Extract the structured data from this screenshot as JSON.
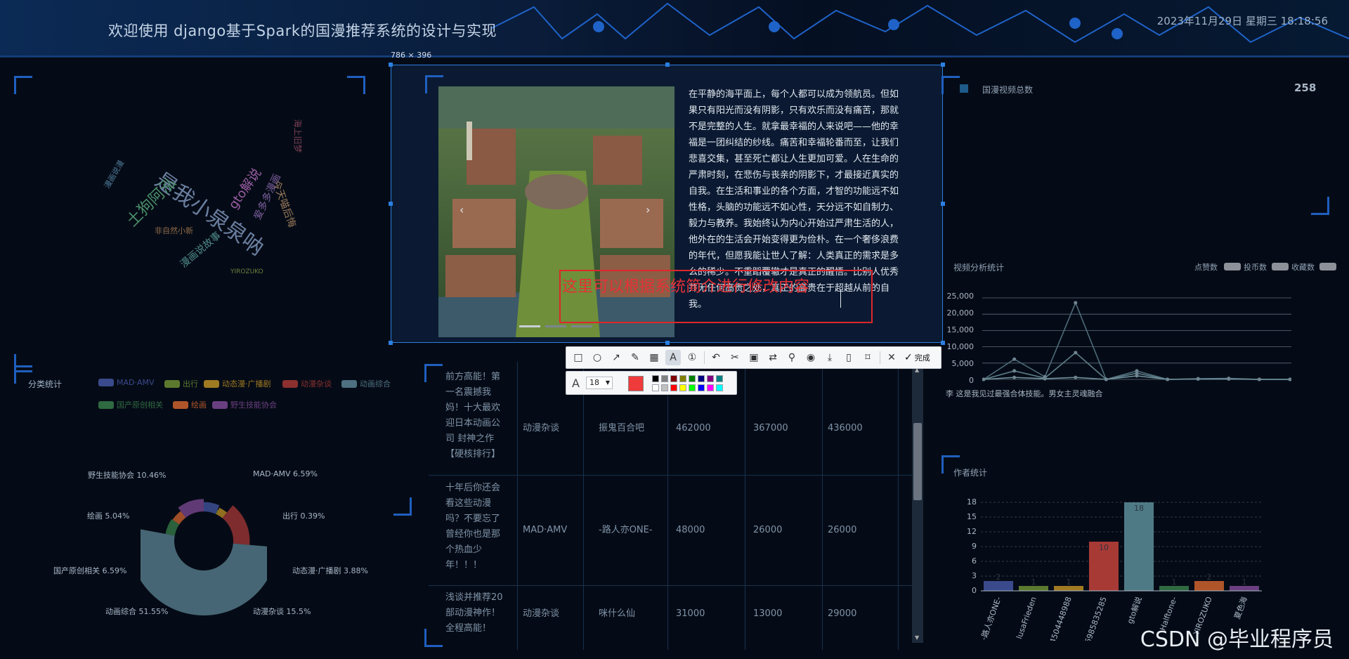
{
  "header": {
    "title": "欢迎使用 django基于Spark的国漫推荐系统的设计与实现",
    "datetime": "2023年11月29日 星期三 18:18:56"
  },
  "wordcloud": {
    "words": [
      {
        "text": "是我小泉泉呐",
        "color": "#6b7fa0"
      },
      {
        "text": "土狗阿泓",
        "color": "#4b8f6a"
      },
      {
        "text": "gto解说",
        "color": "#9a5ea3"
      },
      {
        "text": "爱多多漫画",
        "color": "#7c5f9e"
      },
      {
        "text": "今天喵后悔",
        "color": "#9a7a5a"
      },
      {
        "text": "漫画说故事",
        "color": "#4e8a8a"
      },
      {
        "text": "非自然小新",
        "color": "#8f6a4a"
      },
      {
        "text": "海上旧梦",
        "color": "#7a3f55"
      },
      {
        "text": "YIROZUKO",
        "color": "#6d7f3f"
      },
      {
        "text": "漫画说漫",
        "color": "#4f7b9a"
      }
    ]
  },
  "category": {
    "title": "分类统计",
    "legend": [
      {
        "label": "MAD·AMV",
        "color": "#3a4a8c"
      },
      {
        "label": "出行",
        "color": "#5c7a2e"
      },
      {
        "label": "动态漫·广播剧",
        "color": "#a07a22"
      },
      {
        "label": "动漫杂谈",
        "color": "#8c3030"
      },
      {
        "label": "动画综合",
        "color": "#4e7080"
      },
      {
        "label": "国产原创相关",
        "color": "#2f6a40"
      },
      {
        "label": "绘画",
        "color": "#b0552a"
      },
      {
        "label": "野生技能协会",
        "color": "#6a3f80"
      }
    ],
    "pie_labels": [
      "野生技能协会 10.46%",
      "MAD·AMV 6.59%",
      "绘画 5.04%",
      "出行 0.39%",
      "国产原创相关 6.59%",
      "动态漫·广播剧 3.88%",
      "动画综合 51.55%",
      "动漫杂谈 15.5%"
    ]
  },
  "table": {
    "rows": [
      {
        "title": "前方高能！第一名震撼我妈！十大最欢迎日本动画公司 封神之作【硬核排行】",
        "category": "动漫杂谈",
        "author": "振鬼百合吧",
        "c1": "462000",
        "c2": "367000",
        "c3": "436000"
      },
      {
        "title": "十年后你还会看这些动漫吗？不要忘了曾经你也是那个热血少年！！！",
        "category": "MAD·AMV",
        "author": "-路人亦ONE-",
        "c1": "48000",
        "c2": "26000",
        "c3": "26000"
      },
      {
        "title": "浅谈并推荐20部动漫神作！全程高能！",
        "category": "动漫杂谈",
        "author": "咪什么仙",
        "c1": "31000",
        "c2": "13000",
        "c3": "29000"
      }
    ]
  },
  "selection": {
    "size_label": "786 × 396",
    "slide_text": "在平静的海平面上，每个人都可以成为领航员。但如果只有阳光而没有阴影，只有欢乐而没有痛苦，那就不是完整的人生。就拿最幸福的人来说吧——他的幸福是一团纠结的纱线。痛苦和幸福轮番而至，让我们悲喜交集，甚至死亡都让人生更加可爱。人在生命的严肃时刻，在悲伤与丧亲的阴影下，才最接近真实的自我。在生活和事业的各个方面，才智的功能远不如性格，头脑的功能远不如心性，天分远不如自制力、毅力与教养。我始终认为内心开始过严肃生活的人，他外在的生活会开始变得更为俭朴。在一个奢侈浪费的年代，但愿我能让世人了解：人类真正的需求是多么的稀少。不重蹈覆辙才是真正的醒悟。比别人优秀并无任何高贵之处，真正的高贵在于超越从前的自我。",
    "annotation": "这里可以根据系统简介进行修改内容",
    "arrow_prev": "‹",
    "arrow_next": "›"
  },
  "toolbar": {
    "done_label": "完成",
    "font_size": "18",
    "tools": [
      "rectangle-icon",
      "ellipse-icon",
      "arrow-icon",
      "pen-icon",
      "mosaic-icon",
      "text-icon",
      "serial-number-icon",
      "undo-icon",
      "scissor-icon",
      "ocr-icon",
      "translate-icon",
      "pin-icon",
      "record-icon",
      "download-icon",
      "long-screenshot-icon",
      "bookmark-icon",
      "close-icon",
      "check-icon"
    ],
    "selected_color": "#ef3b3b",
    "palette": [
      "#000000",
      "#808080",
      "#800000",
      "#808000",
      "#008000",
      "#000080",
      "#800080",
      "#008080",
      "#ffffff",
      "#c0c0c0",
      "#ff0000",
      "#ffff00",
      "#00ff00",
      "#0000ff",
      "#ff00ff",
      "#00ffff"
    ]
  },
  "total": {
    "label": "国漫视频总数",
    "value": "258"
  },
  "analysis": {
    "title": "视频分析统计",
    "legend": [
      "点赞数",
      "投币数",
      "收藏数"
    ],
    "y_ticks": [
      "25,000",
      "20,000",
      "15,000",
      "10,000",
      "5,000",
      "0"
    ],
    "caption": "李 这是我见过最强合体技能。男女主灵魂融合"
  },
  "author": {
    "title": "作者统计",
    "y_ticks": [
      "18",
      "15",
      "12",
      "9",
      "6",
      "3",
      "0"
    ],
    "x_labels": [
      "-路人亦ONE-",
      "lusaFrieden",
      "4504448988",
      "6985835285",
      "gto解说",
      "Halftone-",
      "YIROZUKO",
      "夏色海"
    ]
  },
  "watermark": "CSDN @毕业程序员",
  "chart_data": [
    {
      "type": "pie",
      "title": "分类统计",
      "categories": [
        "MAD·AMV",
        "出行",
        "动态漫·广播剧",
        "动漫杂谈",
        "动画综合",
        "国产原创相关",
        "绘画",
        "野生技能协会"
      ],
      "values": [
        6.59,
        0.39,
        3.88,
        15.5,
        51.55,
        6.59,
        5.04,
        10.46
      ]
    },
    {
      "type": "line",
      "title": "视频分析统计",
      "x": [
        1,
        2,
        3,
        4,
        5,
        6,
        7,
        8,
        9,
        10,
        11
      ],
      "ylim": [
        0,
        25000
      ],
      "series": [
        {
          "name": "点赞数",
          "values": [
            0,
            6200,
            800,
            23500,
            0,
            2600,
            0,
            200,
            300,
            0,
            0
          ]
        },
        {
          "name": "投币数",
          "values": [
            0,
            2600,
            400,
            8200,
            0,
            1900,
            0,
            150,
            200,
            0,
            0
          ]
        },
        {
          "name": "收藏数",
          "values": [
            0,
            600,
            200,
            600,
            0,
            1100,
            0,
            100,
            100,
            0,
            0
          ]
        }
      ]
    },
    {
      "type": "bar",
      "title": "作者统计",
      "categories": [
        "-路人亦ONE-",
        "lusaFrieden",
        "4504448988",
        "6985835285",
        "gto解说",
        "Halftone-",
        "YIROZUKO",
        "夏色海"
      ],
      "values": [
        2,
        1,
        1,
        10,
        18,
        1,
        2,
        1
      ],
      "colors": [
        "#3a4a8c",
        "#5c7a2e",
        "#a07a22",
        "#a83a36",
        "#4e7a85",
        "#2f6a40",
        "#b0552a",
        "#6a3f80"
      ],
      "ylim": [
        0,
        18
      ]
    }
  ]
}
